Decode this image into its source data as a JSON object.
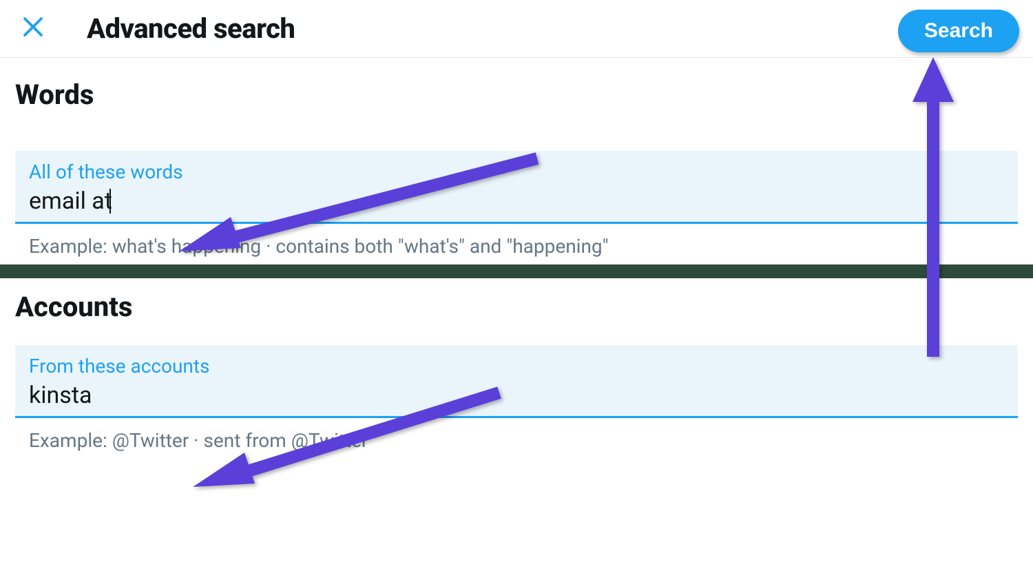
{
  "header": {
    "title": "Advanced search",
    "search_button": "Search",
    "close_icon": "close-icon"
  },
  "sections": {
    "words": {
      "title": "Words",
      "field": {
        "label": "All of these words",
        "value": "email at",
        "example": "Example: what's happening · contains both \"what's\" and \"happening\""
      }
    },
    "accounts": {
      "title": "Accounts",
      "field": {
        "label": "From these accounts",
        "value": "kinsta",
        "example": "Example: @Twitter · sent from @Twitter"
      }
    }
  },
  "colors": {
    "accent": "#1da1f2",
    "annotation": "#5b3fd9",
    "text_primary": "#14171a",
    "text_secondary": "#657786",
    "input_bg": "#eaf5fb"
  }
}
